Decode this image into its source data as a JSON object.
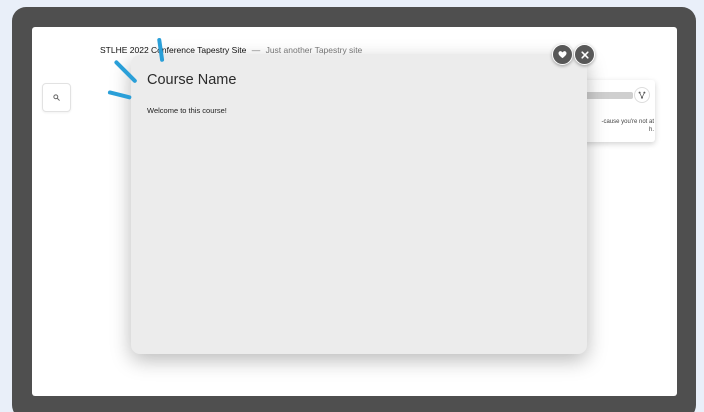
{
  "site": {
    "title": "STLHE 2022 Conference Tapestry Site",
    "separator": "—",
    "tagline": "Just another Tapestry site"
  },
  "sidebar": {
    "search_icon": "search-icon"
  },
  "side_card": {
    "icon": "branch-icon",
    "text": "-cause you're not at\nh."
  },
  "modal": {
    "title": "Course Name",
    "body": "Welcome to this course!",
    "favorite_icon": "heart-icon",
    "close_icon": "close-icon"
  },
  "colors": {
    "frame": "#4f4f4f",
    "modal_bg": "#ececec",
    "accent": "#2a9fd8",
    "button_bg": "#585858"
  }
}
